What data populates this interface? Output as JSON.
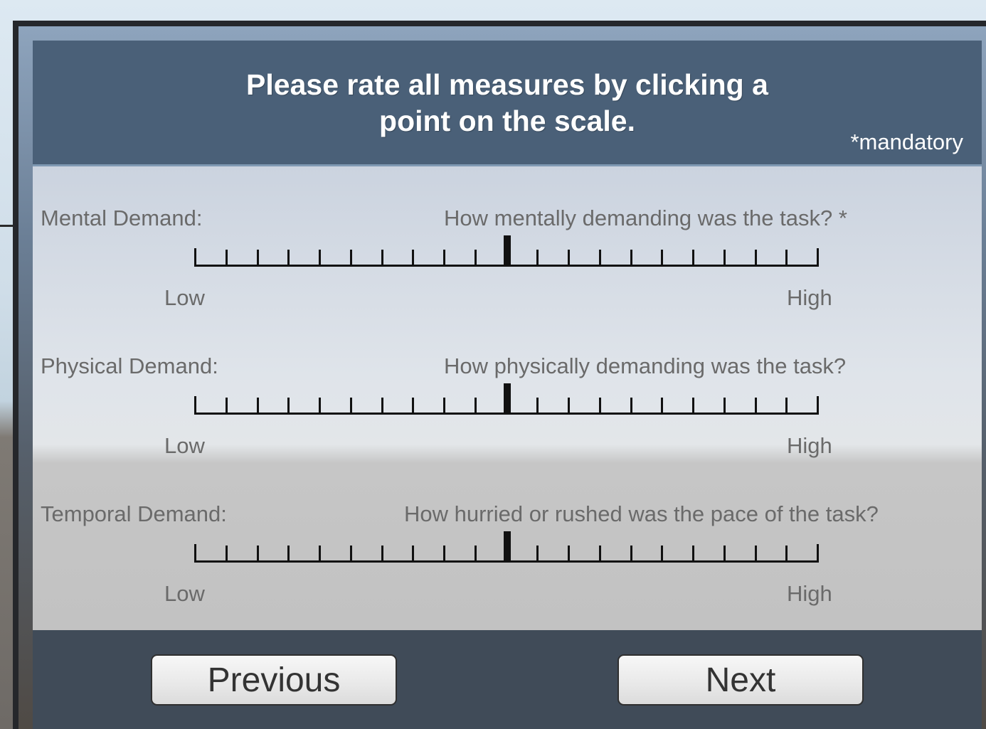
{
  "header": {
    "title": "Please rate all measures by clicking a\npoint on the scale.",
    "mandatory_note": "*mandatory"
  },
  "measures": [
    {
      "label": "Mental Demand:",
      "question": "How mentally demanding was the task? *",
      "low_label": "Low",
      "high_label": "High",
      "tick_count": 21,
      "selected_tick": 10
    },
    {
      "label": "Physical Demand:",
      "question": "How physically demanding was the task?",
      "low_label": "Low",
      "high_label": "High",
      "tick_count": 21,
      "selected_tick": 10
    },
    {
      "label": "Temporal Demand:",
      "question": "How hurried or rushed was the pace of the task?",
      "low_label": "Low",
      "high_label": "High",
      "tick_count": 21,
      "selected_tick": 10
    }
  ],
  "footer": {
    "previous_label": "Previous",
    "next_label": "Next"
  },
  "colors": {
    "header_bg": "#4a6078",
    "footer_bg": "#404b58",
    "scale_color": "#111111"
  }
}
